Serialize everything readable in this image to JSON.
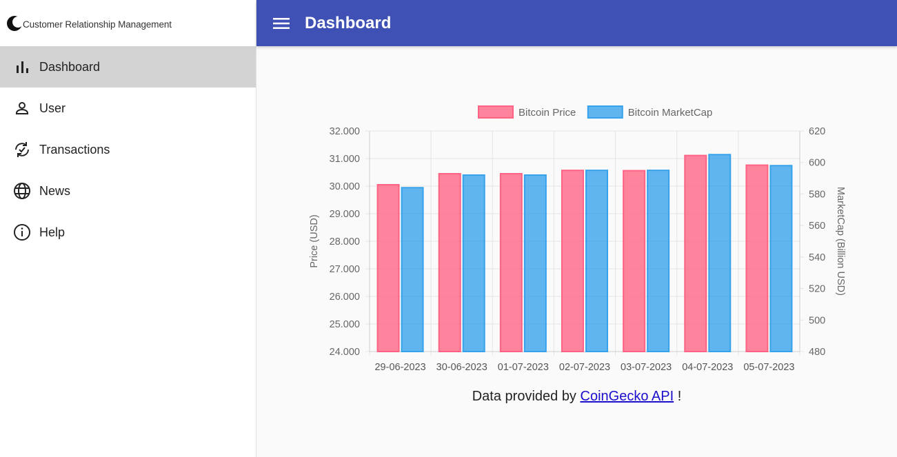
{
  "brand": {
    "name": "Customer Relationship Management"
  },
  "sidebar": {
    "items": [
      {
        "label": "Dashboard",
        "icon": "bar-chart-icon",
        "active": true
      },
      {
        "label": "User",
        "icon": "person-icon",
        "active": false
      },
      {
        "label": "Transactions",
        "icon": "sync-check-icon",
        "active": false
      },
      {
        "label": "News",
        "icon": "globe-icon",
        "active": false
      },
      {
        "label": "Help",
        "icon": "info-icon",
        "active": false
      }
    ]
  },
  "appbar": {
    "title": "Dashboard",
    "accent": "#3f51b5"
  },
  "credit": {
    "prefix": "Data provided by",
    "link_text": "CoinGecko API",
    "suffix": "!"
  },
  "chart_data": {
    "type": "bar",
    "categories": [
      "29-06-2023",
      "30-06-2023",
      "01-07-2023",
      "02-07-2023",
      "03-07-2023",
      "04-07-2023",
      "05-07-2023"
    ],
    "series": [
      {
        "name": "Bitcoin Price",
        "axis": "left",
        "color": "#ff6384",
        "values": [
          30050,
          30450,
          30450,
          30570,
          30560,
          31110,
          30760
        ]
      },
      {
        "name": "Bitcoin MarketCap",
        "axis": "right",
        "color": "#36a2eb",
        "values": [
          584,
          592,
          592,
          595,
          595,
          605,
          598
        ]
      }
    ],
    "ylabel_left": "Price (USD)",
    "ylabel_right": "MarketCap (Billion USD)",
    "ylim_left": [
      24000,
      32000
    ],
    "ylim_right": [
      480,
      620
    ],
    "yticks_left": [
      "24.000",
      "25.000",
      "26.000",
      "27.000",
      "28.000",
      "29.000",
      "30.000",
      "31.000",
      "32.000"
    ],
    "yticks_right": [
      "480",
      "500",
      "520",
      "540",
      "560",
      "580",
      "600",
      "620"
    ],
    "legend": "top",
    "grid": true
  }
}
